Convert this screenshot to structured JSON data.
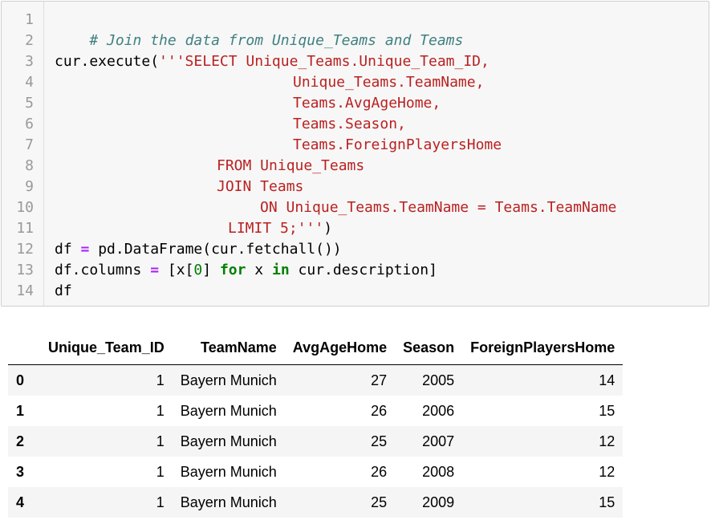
{
  "code_cell": {
    "line_numbers": [
      "1",
      "2",
      "3",
      "4",
      "5",
      "6",
      "7",
      "8",
      "9",
      "10",
      "11",
      "12",
      "13",
      "14"
    ],
    "comment": "# Join the data from Unique_Teams and Teams",
    "l3_a": "cur.execute(",
    "l3_b": "'''SELECT Unique_Teams.Unique_Team_ID,",
    "l4": "Unique_Teams.TeamName,",
    "l5": "Teams.AvgAgeHome,",
    "l6": "Teams.Season,",
    "l7": "Teams.ForeignPlayersHome",
    "l8": "FROM Unique_Teams",
    "l9": "JOIN Teams",
    "l10": "ON Unique_Teams.TeamName = Teams.TeamName",
    "l11_a": "LIMIT 5;'''",
    "l11_b": ")",
    "l12_a": "df ",
    "l12_op": "=",
    "l12_b": " pd.DataFrame(cur.fetchall())",
    "l13_a": "df.columns ",
    "l13_op": "=",
    "l13_b": " [x[",
    "l13_num": "0",
    "l13_c": "] ",
    "l13_kw1": "for",
    "l13_d": " x ",
    "l13_kw2": "in",
    "l13_e": " cur.description]",
    "l14": "df"
  },
  "dataframe": {
    "columns": [
      "",
      "Unique_Team_ID",
      "TeamName",
      "AvgAgeHome",
      "Season",
      "ForeignPlayersHome"
    ],
    "rows": [
      {
        "index": "0",
        "Unique_Team_ID": "1",
        "TeamName": "Bayern Munich",
        "AvgAgeHome": "27",
        "Season": "2005",
        "ForeignPlayersHome": "14"
      },
      {
        "index": "1",
        "Unique_Team_ID": "1",
        "TeamName": "Bayern Munich",
        "AvgAgeHome": "26",
        "Season": "2006",
        "ForeignPlayersHome": "15"
      },
      {
        "index": "2",
        "Unique_Team_ID": "1",
        "TeamName": "Bayern Munich",
        "AvgAgeHome": "25",
        "Season": "2007",
        "ForeignPlayersHome": "12"
      },
      {
        "index": "3",
        "Unique_Team_ID": "1",
        "TeamName": "Bayern Munich",
        "AvgAgeHome": "26",
        "Season": "2008",
        "ForeignPlayersHome": "12"
      },
      {
        "index": "4",
        "Unique_Team_ID": "1",
        "TeamName": "Bayern Munich",
        "AvgAgeHome": "25",
        "Season": "2009",
        "ForeignPlayersHome": "15"
      }
    ]
  },
  "colors": {
    "comment": "#408080",
    "string": "#ba2121",
    "keyword": "#008000",
    "operator": "#aa22ff",
    "line_number": "#999999",
    "cell_background": "#f7f7f7"
  }
}
